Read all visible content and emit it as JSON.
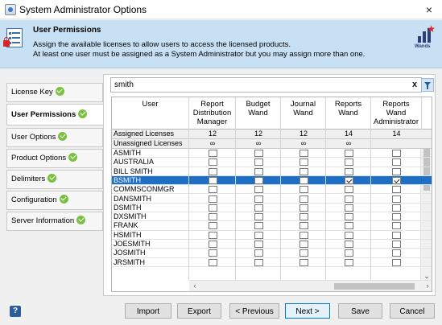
{
  "window": {
    "title": "System Administrator Options",
    "close": "×"
  },
  "header": {
    "title": "User Permissions",
    "desc_line1": "Assign the available licenses to allow users to access the licensed products.",
    "desc_line2": "At least one user must be assigned as a System Administrator but you may assign more than one.",
    "logo_text": "Wands"
  },
  "nav": {
    "items": [
      {
        "label": "License Key",
        "active": false
      },
      {
        "label": "User Permissions",
        "active": true
      },
      {
        "label": "User Options",
        "active": false
      },
      {
        "label": "Product Options",
        "active": false
      },
      {
        "label": "Delimiters",
        "active": false
      },
      {
        "label": "Configuration",
        "active": false
      },
      {
        "label": "Server Information",
        "active": false
      }
    ]
  },
  "search": {
    "value": "smith",
    "clear": "x"
  },
  "grid": {
    "user_header": "User",
    "columns": [
      "Report\nDistribution\nManager",
      "Budget\nWand",
      "Journal\nWand",
      "Reports\nWand",
      "Reports\nWand\nAdministrator"
    ],
    "assigned_label": "Assigned Licenses",
    "assigned": [
      "12",
      "12",
      "12",
      "14",
      "14"
    ],
    "unassigned_label": "Unassigned Licenses",
    "unassigned": [
      "∞",
      "∞",
      "∞",
      "∞",
      ""
    ],
    "selected_user": "BSMITH",
    "users": [
      {
        "name": "ASMITH",
        "checks": [
          false,
          false,
          false,
          false,
          false
        ]
      },
      {
        "name": "AUSTRALIA",
        "checks": [
          false,
          false,
          false,
          false,
          false
        ]
      },
      {
        "name": "BILL SMITH",
        "checks": [
          false,
          false,
          false,
          false,
          false
        ]
      },
      {
        "name": "BSMITH",
        "checks": [
          false,
          false,
          false,
          true,
          true
        ]
      },
      {
        "name": "COMMSCONMGR",
        "checks": [
          false,
          false,
          false,
          false,
          false
        ]
      },
      {
        "name": "DANSMITH",
        "checks": [
          false,
          false,
          false,
          false,
          false
        ]
      },
      {
        "name": "DSMITH",
        "checks": [
          false,
          false,
          false,
          false,
          false
        ]
      },
      {
        "name": "DXSMITH",
        "checks": [
          false,
          false,
          false,
          false,
          false
        ]
      },
      {
        "name": "FRANK",
        "checks": [
          false,
          false,
          false,
          false,
          false
        ]
      },
      {
        "name": "HSMITH",
        "checks": [
          false,
          false,
          false,
          false,
          false
        ]
      },
      {
        "name": "JOESMITH",
        "checks": [
          false,
          false,
          false,
          false,
          false
        ]
      },
      {
        "name": "JOSMITH",
        "checks": [
          false,
          false,
          false,
          false,
          false
        ]
      },
      {
        "name": "JRSMITH",
        "checks": [
          false,
          false,
          false,
          false,
          false
        ]
      }
    ]
  },
  "footer": {
    "help": "?",
    "import": "Import",
    "export": "Export",
    "previous": "< Previous",
    "next": "Next >",
    "save": "Save",
    "cancel": "Cancel"
  }
}
